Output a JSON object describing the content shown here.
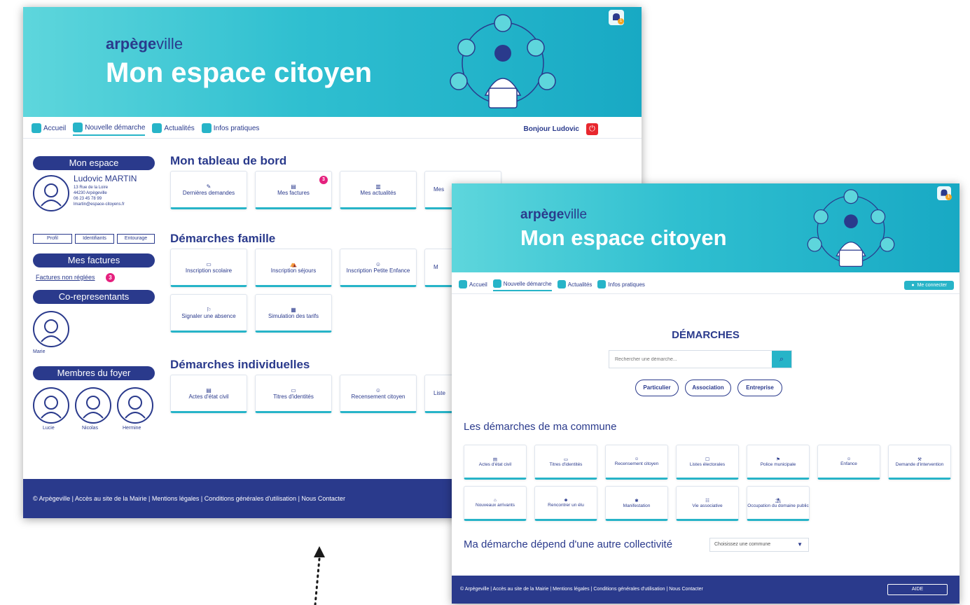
{
  "colors": {
    "navy": "#2a3a8c",
    "teal": "#27b4c8",
    "pink": "#e5207e",
    "orange": "#f5a623",
    "red": "#e8272e"
  },
  "brand": {
    "name_bold": "arpège",
    "name_light": "ville",
    "title": "Mon espace citoyen"
  },
  "nav": {
    "home": "Accueil",
    "new_request": "Nouvelle démarche",
    "news": "Actualités",
    "info": "Infos pratiques"
  },
  "w1": {
    "greeting": "Bonjour Ludovic",
    "bell_count": "1",
    "my_space": "Mon espace",
    "user": {
      "name": "Ludovic MARTIN",
      "line1": "13 Rue de la Loire",
      "line2": "44230 Arpègeville",
      "line3": "06 23 45 78 99",
      "line4": "lmartin@espace-citoyens.fr"
    },
    "buttons": [
      "Profil",
      "Identifiants",
      "Entourage"
    ],
    "invoices_title": "Mes factures",
    "unpaid_link": "Factures non réglées",
    "unpaid_count": "3",
    "coreps_title": "Co-representants",
    "corep_name": "Marie",
    "household_title": "Membres du foyer",
    "household": [
      "Lucie",
      "Nicolas",
      "Hermine"
    ],
    "dashboard_title": "Mon tableau de bord",
    "dashboard": [
      "Dernières demandes",
      "Mes factures",
      "Mes actualités",
      "Mes"
    ],
    "dashboard_badge": "3",
    "family_title": "Démarches famille",
    "family": [
      "Inscription scolaire",
      "Inscription séjours",
      "Inscription Petite Enfance",
      "M",
      "Signaler une absence",
      "Simulation des tarifs"
    ],
    "individual_title": "Démarches individuelles",
    "individual": [
      "Actes d'état civil",
      "Titres d'identités",
      "Recensement citoyen",
      "Liste"
    ],
    "footer": "© Arpègeville | Accès au site de la Mairie | Mentions légales | Conditions générales d'utilisation | Nous Contacter"
  },
  "w2": {
    "bell_count": "1",
    "connect": "Me connecter",
    "page_title": "DÉMARCHES",
    "search_placeholder": "Rechercher une démarche...",
    "filters": [
      "Particulier",
      "Association",
      "Entreprise"
    ],
    "commune_title": "Les démarches de ma commune",
    "tiles": [
      "Actes d'état civil",
      "Titres d'identités",
      "Recensement citoyen",
      "Listes électorales",
      "Police municipale",
      "Enfance",
      "Demande d'intervention",
      "Nouveaux arrivants",
      "Rencontrer un élu",
      "Manifestation",
      "Vie associative",
      "Occupation du domaine public"
    ],
    "other_title": "Ma démarche dépend d'une autre collectivité",
    "select_value": "Choisissez une commune",
    "footer": "© Arpègeville | Accès au site de la Mairie | Mentions légales | Conditions générales d'utilisation | Nous Contacter",
    "help": "AIDE"
  }
}
